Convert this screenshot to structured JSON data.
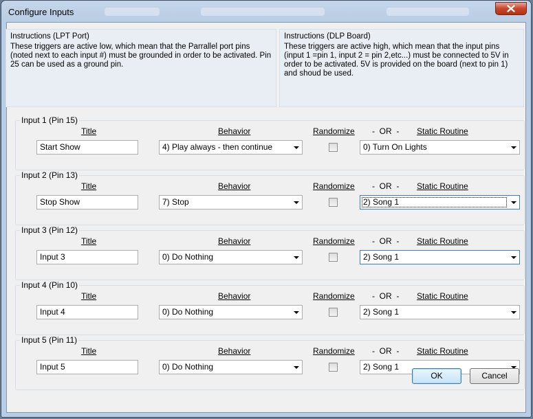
{
  "window": {
    "title": "Configure Inputs"
  },
  "instructions": {
    "lpt": {
      "heading": "Instructions (LPT Port)",
      "body": "These triggers are active low, which mean that the Parrallel port pins (noted next to each input #) must be grounded in order to be activated. Pin 25 can be used as a ground pin."
    },
    "dlp": {
      "heading": "Instructions (DLP Board)",
      "body": "These triggers are active high, which mean that the input pins (input 1 =pin 1, input 2 = pin 2,etc...) must be connected  to 5V in order to be activated. 5V is provided on the board (next to pin 1) and shoud be used."
    }
  },
  "columns": {
    "title": "Title",
    "behavior": "Behavior",
    "randomize": "Randomize",
    "or": "-  OR  -",
    "static": "Static Routine"
  },
  "inputs": [
    {
      "label": "Input 1 (Pin 15)",
      "title": "Start Show",
      "behavior": "4) Play always - then continue",
      "static": "0) Turn On Lights"
    },
    {
      "label": "Input 2 (Pin 13)",
      "title": "Stop Show",
      "behavior": "7) Stop",
      "static": "2) Song 1"
    },
    {
      "label": "Input 3 (Pin 12)",
      "title": "Input 3",
      "behavior": "0) Do Nothing",
      "static": "2) Song 1"
    },
    {
      "label": "Input 4 (Pin 10)",
      "title": "Input 4",
      "behavior": "0) Do Nothing",
      "static": "2) Song 1"
    },
    {
      "label": "Input 5 (Pin 11)",
      "title": "Input 5",
      "behavior": "0) Do Nothing",
      "static": "2) Song 1"
    }
  ],
  "buttons": {
    "ok": "OK",
    "cancel": "Cancel"
  },
  "icons": {
    "close": "close-x-icon",
    "dropdown": "chevron-down-icon"
  }
}
